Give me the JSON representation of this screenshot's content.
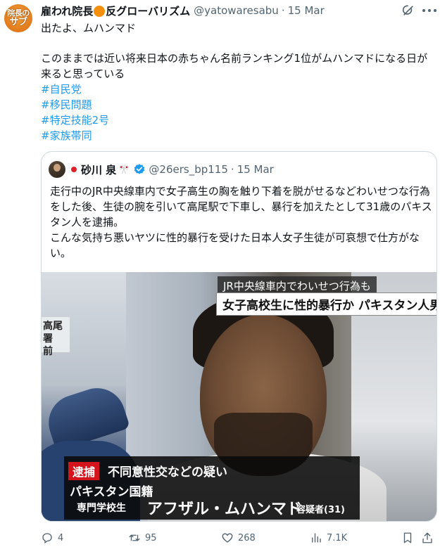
{
  "author": {
    "avatar_line1": "院長の",
    "avatar_line2": "サブ",
    "name_part1": "雇われ院長",
    "name_part2": "反グローバリズム",
    "handle": "@yatowaresabu",
    "separator": "·",
    "date": "15 Mar"
  },
  "tweet": {
    "line1": "出たよ、ムハンマド",
    "line2": "このままでは近い将来日本の赤ちゃん名前ランキング1位がムハンマドになる日が来ると思っている",
    "hashtags": [
      "#自民党",
      "#移民問題",
      "#特定技能2号",
      "#家族帯同"
    ]
  },
  "quote": {
    "name": "砂川 泉",
    "mark": "🎌",
    "handle": "@26ers_bp115",
    "separator": "·",
    "date": "15 Mar",
    "text": "走行中のJR中央線車内で女子高生の胸を触り下着を脱がせるなどわいせつな行為をした後、生徒の腕を引いて高尾駅で下車し、暴行を加えたとして31歳のパキスタン人を逮捕。\nこんな気持ち悪いヤツに性的暴行を受けた日本人女子生徒が可哀想で仕方がない。"
  },
  "media": {
    "sign": "高尾署\n前",
    "caption_top": "JR中央線車内でわいせつ行為も",
    "caption_main": "女子高校生に性的暴行か パキスタン人男逮捕",
    "arrest_tag": "逮捕",
    "suspicion": "不同意性交などの疑い",
    "nationality": "パキスタン国籍",
    "school": "専門学校生",
    "suspect_name": "アフザル・ムハンマド",
    "suspect_suffix": "容疑者(31)"
  },
  "actions": {
    "replies": "4",
    "retweets": "95",
    "likes": "268",
    "views": "7.1K"
  },
  "colors": {
    "link": "#1d9bf0",
    "muted": "#536471",
    "verified": "#1d9bf0",
    "arrest_red": "#d3141c"
  }
}
